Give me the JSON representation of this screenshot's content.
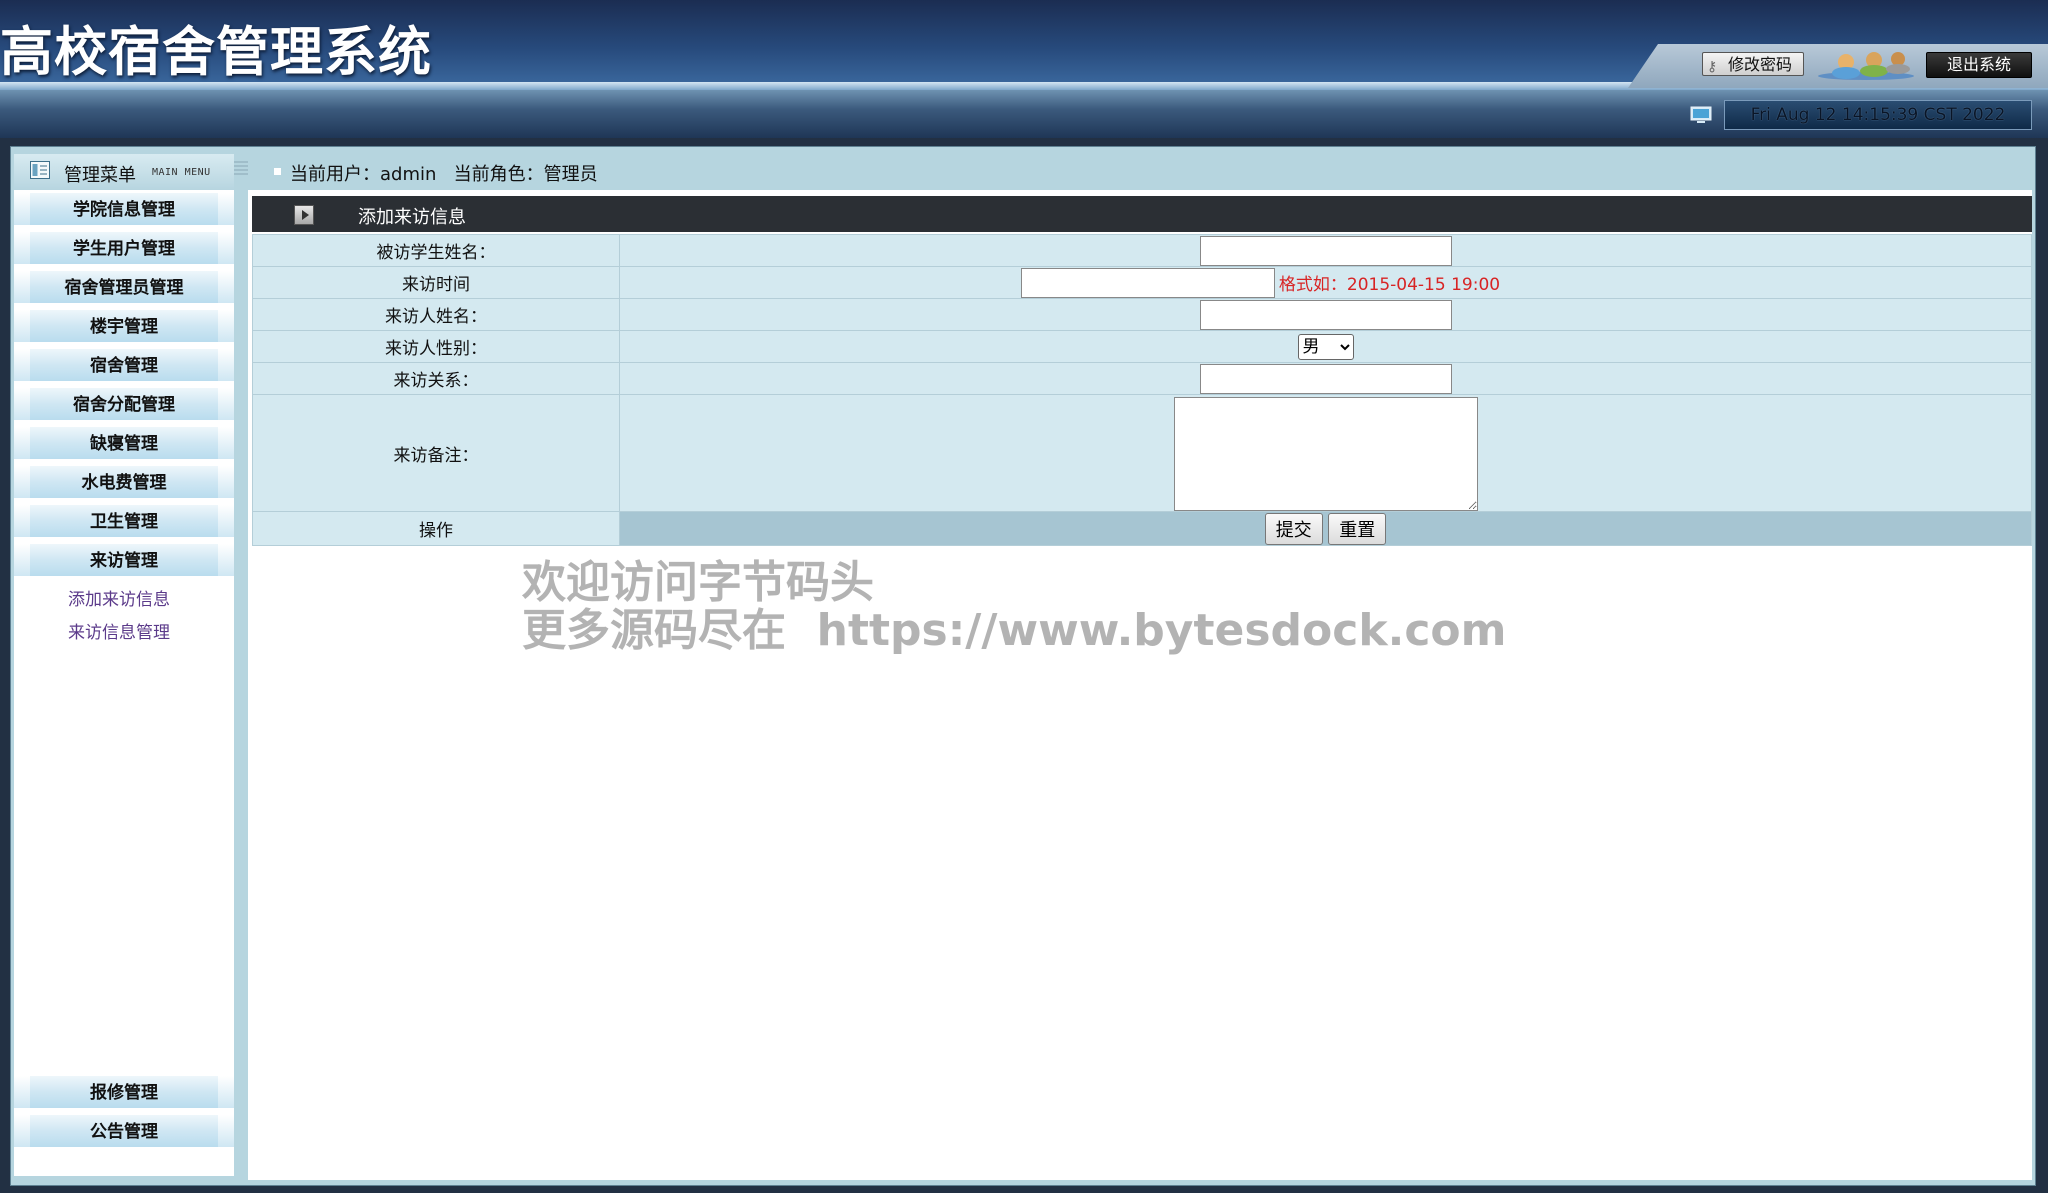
{
  "app": {
    "title": "高校宿舍管理系统",
    "change_password_label": "修改密码",
    "logout_label": "退出系统",
    "datetime": "Fri Aug 12 14:15:39 CST 2022"
  },
  "menu": {
    "title": "管理菜单",
    "subtitle": "MAIN MENU",
    "items": [
      {
        "label": "学院信息管理"
      },
      {
        "label": "学生用户管理"
      },
      {
        "label": "宿舍管理员管理"
      },
      {
        "label": "楼宇管理"
      },
      {
        "label": "宿舍管理"
      },
      {
        "label": "宿舍分配管理"
      },
      {
        "label": "缺寝管理"
      },
      {
        "label": "水电费管理"
      },
      {
        "label": "卫生管理"
      },
      {
        "label": "来访管理"
      }
    ],
    "submenu": [
      {
        "label": "添加来访信息"
      },
      {
        "label": "来访信息管理"
      }
    ],
    "bottom_items": [
      {
        "label": "报修管理"
      },
      {
        "label": "公告管理"
      }
    ]
  },
  "user_bar": {
    "text": "当前用户：admin   当前角色：管理员"
  },
  "form": {
    "title": "添加来访信息",
    "fields": {
      "student_name": {
        "label": "被访学生姓名：",
        "value": ""
      },
      "visit_time": {
        "label": "来访时间",
        "value": "",
        "hint": "格式如：2015-04-15 19:00"
      },
      "visitor_name": {
        "label": "来访人姓名：",
        "value": ""
      },
      "visitor_sex": {
        "label": "来访人性别：",
        "selected": "男",
        "options": [
          "男"
        ]
      },
      "relation": {
        "label": "来访关系：",
        "value": ""
      },
      "note": {
        "label": "来访备注：",
        "value": ""
      }
    },
    "ops_label": "操作",
    "submit_label": "提交",
    "reset_label": "重置"
  },
  "watermark": {
    "line1": "欢迎访问字节码头",
    "line2": "更多源码尽在  https://www.bytesdock.com"
  }
}
